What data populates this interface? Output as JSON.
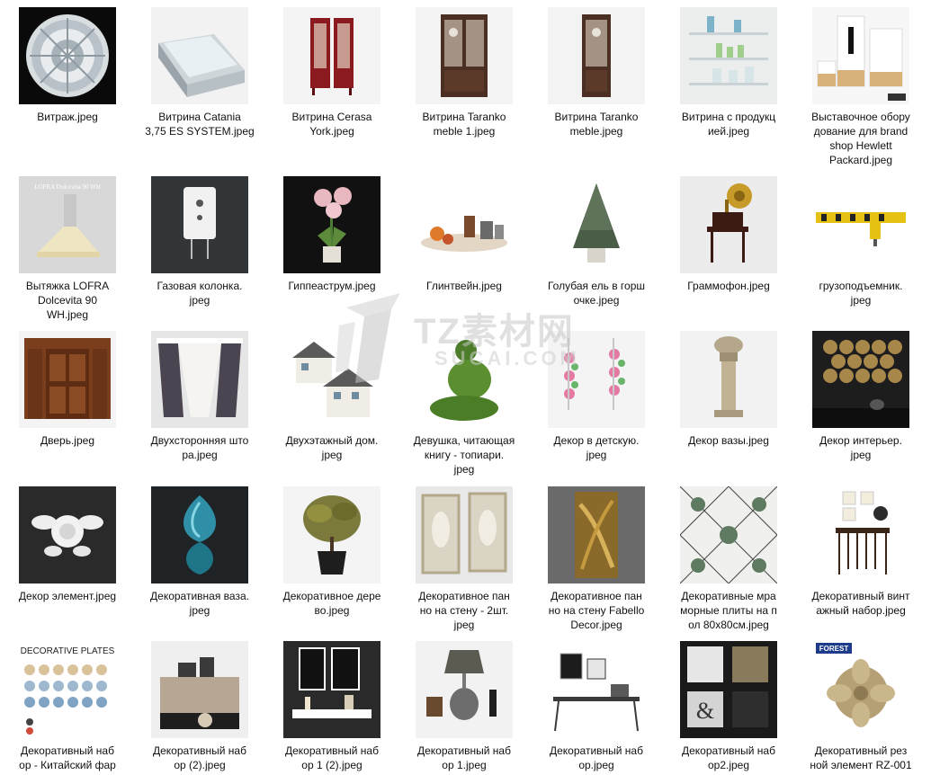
{
  "rows": [
    [
      {
        "label": "Витраж.jpeg",
        "icon": "stained-glass-thumbnail"
      },
      {
        "label": "Витрина Catania\n3,75 ES SYSTEM.jpeg",
        "icon": "display-fridge-thumbnail"
      },
      {
        "label": "Витрина Cerasa\nYork.jpeg",
        "icon": "red-cabinet-thumbnail"
      },
      {
        "label": "Витрина Taranko\nmeble 1.jpeg",
        "icon": "wood-cabinet-thumbnail"
      },
      {
        "label": "Витрина Taranko\nmeble.jpeg",
        "icon": "wood-cabinet-thumbnail"
      },
      {
        "label": "Витрина с продукц\nией.jpeg",
        "icon": "glass-shelf-thumbnail"
      },
      {
        "label": "Выставочное обору\nдование для brand\nshop Hewlett\nPackard.jpeg",
        "icon": "exhibition-stand-thumbnail"
      }
    ],
    [
      {
        "label": "Вытяжка LOFRA\nDolcevita 90\nWH.jpeg",
        "icon": "range-hood-thumbnail",
        "caption": "LOFRA Dolcevita 90 WH"
      },
      {
        "label": "Газовая колонка.\njpeg",
        "icon": "gas-heater-thumbnail"
      },
      {
        "label": "Гиппеаструм.jpeg",
        "icon": "flower-pot-thumbnail"
      },
      {
        "label": "Глинтвейн.jpeg",
        "icon": "mulled-wine-thumbnail"
      },
      {
        "label": "Голубая ель в горш\nочке.jpeg",
        "icon": "spruce-pot-thumbnail"
      },
      {
        "label": "Граммофон.jpeg",
        "icon": "gramophone-thumbnail"
      },
      {
        "label": "грузоподъемник.\njpeg",
        "icon": "crane-thumbnail"
      }
    ],
    [
      {
        "label": "Дверь.jpeg",
        "icon": "wooden-door-thumbnail"
      },
      {
        "label": "Двухсторонняя што\nра.jpeg",
        "icon": "curtain-thumbnail"
      },
      {
        "label": "Двухэтажный дом.\njpeg",
        "icon": "house-thumbnail"
      },
      {
        "label": "Девушка, читающая\nкнигу - топиари.\njpeg",
        "icon": "topiary-thumbnail"
      },
      {
        "label": "Декор в детскую.\njpeg",
        "icon": "kids-decor-thumbnail"
      },
      {
        "label": "Декор вазы.jpeg",
        "icon": "vase-column-thumbnail"
      },
      {
        "label": "Декор интерьер.\njpeg",
        "icon": "interior-decor-thumbnail"
      }
    ],
    [
      {
        "label": "Декор элемент.jpeg",
        "icon": "ornament-thumbnail"
      },
      {
        "label": "Декоративная ваза.\njpeg",
        "icon": "blue-vase-thumbnail"
      },
      {
        "label": "Декоративное дере\nво.jpeg",
        "icon": "decorative-tree-thumbnail"
      },
      {
        "label": "Декоративное пан\nно на стену - 2шт.\njpeg",
        "icon": "wall-panel-thumbnail"
      },
      {
        "label": "Декоративное пан\nно на стену Fabello\nDecor.jpeg",
        "icon": "gold-panel-thumbnail"
      },
      {
        "label": "Декоративные мра\nморные плиты на п\nол 80х80см.jpeg",
        "icon": "marble-tiles-thumbnail"
      },
      {
        "label": "Декоративный винт\nажный набор.jpeg",
        "icon": "vintage-set-thumbnail"
      }
    ],
    [
      {
        "label": "Декоративный наб\nор - Китайский фар",
        "icon": "plates-thumbnail",
        "caption": "DECORATIVE PLATES"
      },
      {
        "label": "Декоративный наб\nор (2).jpeg",
        "icon": "sideboard-set-thumbnail"
      },
      {
        "label": "Декоративный наб\nор 1 (2).jpeg",
        "icon": "photo-set-thumbnail"
      },
      {
        "label": "Декоративный наб\nор 1.jpeg",
        "icon": "lamp-set-thumbnail"
      },
      {
        "label": "Декоративный наб\nор.jpeg",
        "icon": "console-set-thumbnail"
      },
      {
        "label": "Декоративный наб\nор2.jpeg",
        "icon": "shelf-set-thumbnail"
      },
      {
        "label": "Декоративный рез\nной элемент RZ-001",
        "icon": "carved-element-thumbnail",
        "caption": "FOREST"
      }
    ]
  ],
  "watermark": {
    "text": "TZ素材网",
    "subtext": "SUCAI.COM"
  },
  "colors": {
    "label_text": "#111111",
    "background": "#ffffff"
  }
}
